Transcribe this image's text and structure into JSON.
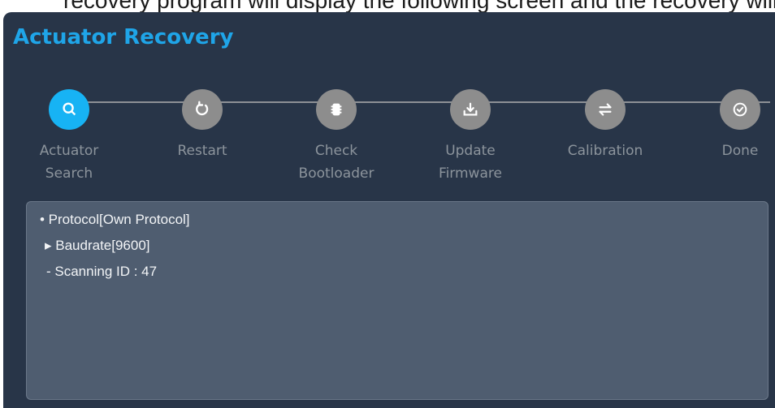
{
  "background_caption": "recovery program will display the following screen and the recovery will be in progress through",
  "title": "Actuator Recovery",
  "steps": [
    {
      "label": "Actuator\nSearch",
      "icon": "search-icon",
      "active": true
    },
    {
      "label": "Restart",
      "icon": "restart-icon",
      "active": false
    },
    {
      "label": "Check\nBootloader",
      "icon": "chip-icon",
      "active": false
    },
    {
      "label": "Update\nFirmware",
      "icon": "download-icon",
      "active": false
    },
    {
      "label": "Calibration",
      "icon": "swap-arrows-icon",
      "active": false
    },
    {
      "label": "Done",
      "icon": "check-circle-icon",
      "active": false
    }
  ],
  "log": [
    "• Protocol[Own Protocol]",
    "▸ Baudrate[9600]",
    "- Scanning ID : 47"
  ],
  "colors": {
    "panel": "#283548",
    "title": "#1fa5e8",
    "active_step": "#17b3f4",
    "inactive_step": "#8d8d8d",
    "log_box": "#4f5d70"
  }
}
